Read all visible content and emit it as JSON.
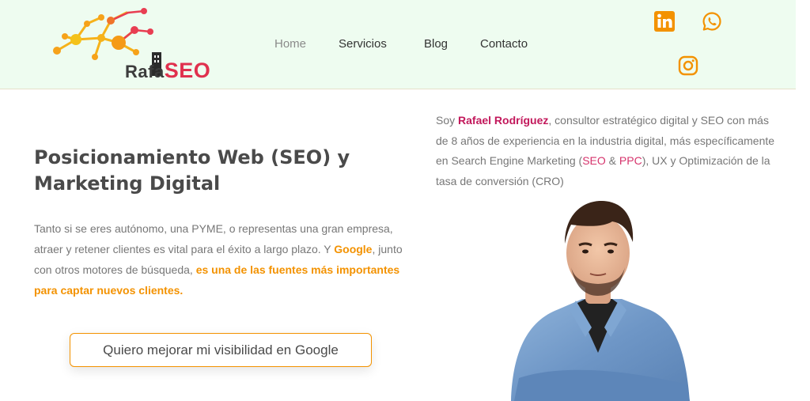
{
  "logo": {
    "part1": "Rafa",
    "part2": "SEO"
  },
  "nav": {
    "items": [
      "Home",
      "Servicios",
      "Blog",
      "Contacto"
    ],
    "active": "Home"
  },
  "social": [
    "linkedin-icon",
    "whatsapp-icon",
    "instagram-icon"
  ],
  "hero": {
    "title": "Posicionamiento Web (SEO) y Marketing Digital",
    "text_1": "Tanto si se eres autónomo, una PYME, o representas una gran empresa, atraer y retener clientes es vital para el éxito a largo plazo. Y ",
    "text_google": "Google",
    "text_2": ", junto con otros motores de búsqueda, ",
    "text_highlight": "es una de las fuentes más importantes para captar nuevos clientes.",
    "cta": "Quiero mejorar mi visibilidad en Google"
  },
  "bio": {
    "intro": "Soy ",
    "name": "Rafael Rodríguez",
    "text_1": ", consultor estratégico digital y SEO con más de 8 años de experiencia en la industria digital, más específicamente en Search Engine Marketing (",
    "seo": "SEO",
    "amp": " & ",
    "ppc": "PPC",
    "text_2": "), UX y Optimización de la tasa de conversión (CRO)"
  },
  "colors": {
    "orange": "#f39200",
    "pink": "#d6336c",
    "header_bg": "#eefcf0"
  }
}
